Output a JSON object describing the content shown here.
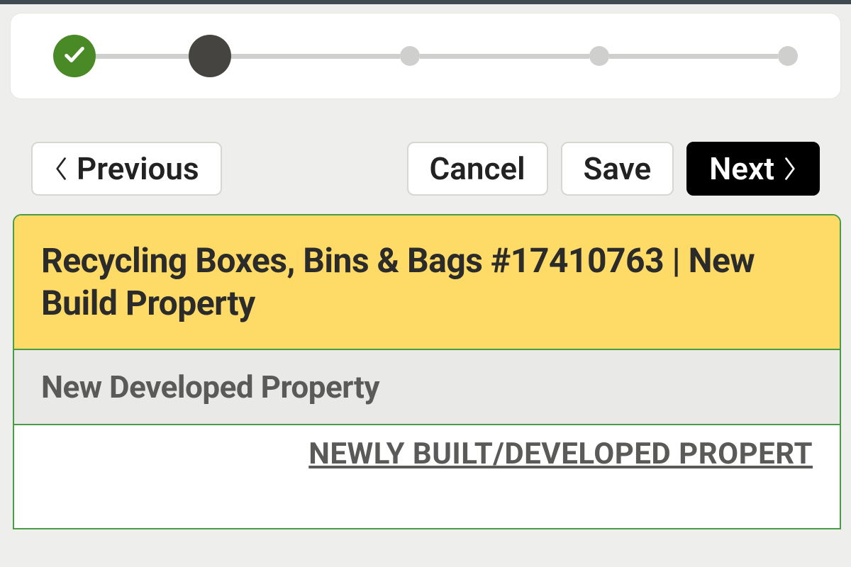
{
  "stepper": {
    "steps": [
      {
        "state": "completed"
      },
      {
        "state": "current"
      },
      {
        "state": "future"
      },
      {
        "state": "future"
      },
      {
        "state": "future"
      }
    ]
  },
  "buttons": {
    "previous": "Previous",
    "cancel": "Cancel",
    "save": "Save",
    "next": "Next"
  },
  "panel": {
    "title": "Recycling Boxes, Bins & Bags #17410763 | New Build Property",
    "subtitle": "New Developed Property",
    "body_heading": "NEWLY BUILT/DEVELOPED PROPERT"
  }
}
